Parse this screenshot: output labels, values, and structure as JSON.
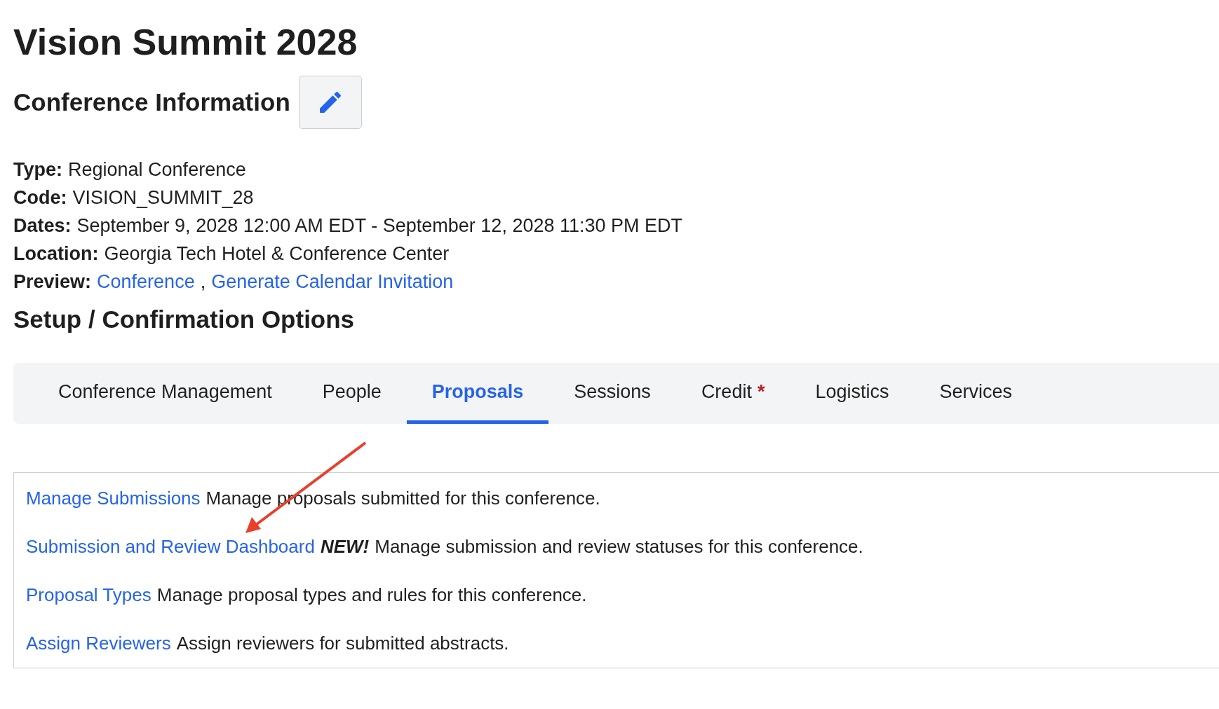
{
  "title": "Vision Summit 2028",
  "info_heading": "Conference Information",
  "fields": [
    {
      "label": "Type:",
      "value": "Regional Conference"
    },
    {
      "label": "Code:",
      "value": "VISION_SUMMIT_28"
    },
    {
      "label": "Dates:",
      "value": "September 9, 2028 12:00 AM EDT - September 12, 2028 11:30 PM EDT"
    },
    {
      "label": "Location:",
      "value": "Georgia Tech Hotel & Conference Center"
    },
    {
      "label": "Preview:",
      "links": [
        "Conference",
        "Generate Calendar Invitation"
      ],
      "separator": ","
    }
  ],
  "setup_heading": "Setup / Confirmation Options",
  "tabs": [
    {
      "label": "Conference Management",
      "selected": false
    },
    {
      "label": "People",
      "selected": false
    },
    {
      "label": "Proposals",
      "selected": true
    },
    {
      "label": "Sessions",
      "selected": false
    },
    {
      "label": "Credit",
      "selected": false,
      "marker": "*"
    },
    {
      "label": "Logistics",
      "selected": false
    },
    {
      "label": "Services",
      "selected": false
    }
  ],
  "options": [
    {
      "link": "Manage Submissions",
      "description": "Manage proposals submitted for this conference."
    },
    {
      "link": "Submission and Review Dashboard",
      "badge": "NEW!",
      "description": "Manage submission and review statuses for this conference."
    },
    {
      "link": "Proposal Types",
      "description": "Manage proposal types and rules for this conference."
    },
    {
      "link": "Assign Reviewers",
      "description": "Assign reviewers for submitted abstracts."
    }
  ]
}
